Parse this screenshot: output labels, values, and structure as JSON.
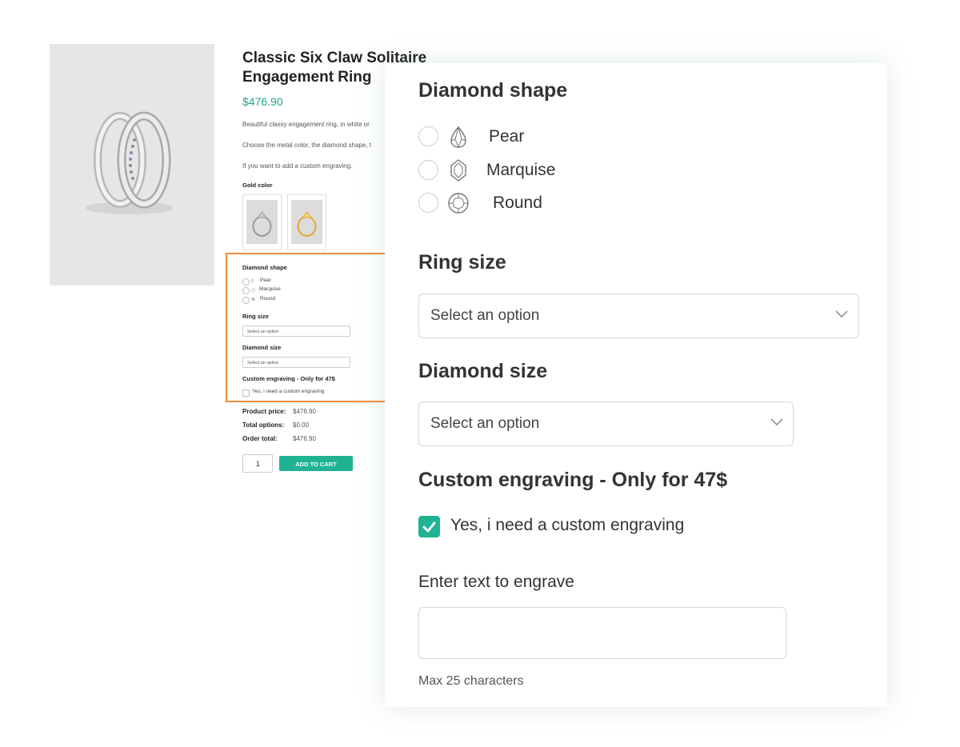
{
  "product": {
    "title": "Classic Six Claw Solitaire Engagement Ring",
    "price": "$476.90",
    "description_lines": [
      "Beautiful classy engagement ring, in white or",
      "Choose the metal color, the diamond shape, t",
      "If you want to add a custom engraving."
    ],
    "gold_color_label": "Gold color",
    "colors": {
      "accent": "#1fb394",
      "price": "#1aa589",
      "highlight_border": "#ef8c3c"
    }
  },
  "mini_options": {
    "diamond_shape_label": "Diamond shape",
    "shapes": [
      "Pear",
      "Marquise",
      "Round"
    ],
    "ring_size_label": "Ring size",
    "ring_size_placeholder": "Select an option",
    "diamond_size_label": "Diamond size",
    "diamond_size_placeholder": "Select an option",
    "engraving_label": "Custom engraving - Only for 47$",
    "engraving_checkbox": "Yes, i need a custom engraving"
  },
  "summary": {
    "product_price_label": "Product price:",
    "product_price_value": "$476.90",
    "total_options_label": "Total options:",
    "total_options_value": "$0.00",
    "order_total_label": "Order total:",
    "order_total_value": "$476.90",
    "quantity": "1",
    "add_to_cart": "ADD TO CART"
  },
  "panel": {
    "diamond_shape_heading": "Diamond shape",
    "shapes": [
      {
        "label": "Pear",
        "icon": "pear-gem-icon"
      },
      {
        "label": "Marquise",
        "icon": "marquise-gem-icon"
      },
      {
        "label": "Round",
        "icon": "round-gem-icon"
      }
    ],
    "ring_size_heading": "Ring size",
    "ring_size_placeholder": "Select an option",
    "diamond_size_heading": "Diamond size",
    "diamond_size_placeholder": "Select an option",
    "engraving_heading": "Custom engraving - Only for 47$",
    "engraving_checkbox_label": "Yes, i need a custom engraving",
    "engraving_checked": true,
    "engrave_text_label": "Enter text to engrave",
    "engrave_text_value": "",
    "max_chars_note": "Max 25 characters"
  }
}
